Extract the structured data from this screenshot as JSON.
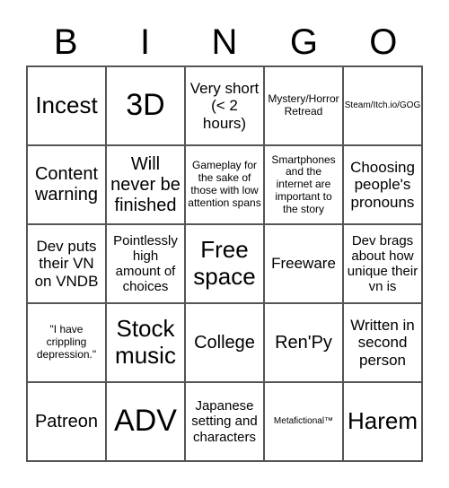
{
  "header": [
    "B",
    "I",
    "N",
    "G",
    "O"
  ],
  "cells": [
    {
      "text": "Incest",
      "size": "s-xl"
    },
    {
      "text": "3D",
      "size": "s-xxl"
    },
    {
      "text": "Very short (< 2 hours)",
      "size": "s-ml"
    },
    {
      "text": "Mystery/Horror Retread",
      "size": "s-s"
    },
    {
      "text": "Steam/Itch.io/GOG",
      "size": "s-xs"
    },
    {
      "text": "Content warning",
      "size": "s-l"
    },
    {
      "text": "Will never be finished",
      "size": "s-l"
    },
    {
      "text": "Gameplay for the sake of those with low attention spans",
      "size": "s-s"
    },
    {
      "text": "Smartphones and the internet are important to the story",
      "size": "s-s"
    },
    {
      "text": "Choosing people's pronouns",
      "size": "s-ml"
    },
    {
      "text": "Dev puts their VN on VNDB",
      "size": "s-ml"
    },
    {
      "text": "Pointlessly high amount of choices",
      "size": "s-m"
    },
    {
      "text": "Free space",
      "size": "s-xl"
    },
    {
      "text": "Freeware",
      "size": "s-ml"
    },
    {
      "text": "Dev brags about how unique their vn is",
      "size": "s-m"
    },
    {
      "text": "\"I have crippling depression.\"",
      "size": "s-s"
    },
    {
      "text": "Stock music",
      "size": "s-xl"
    },
    {
      "text": "College",
      "size": "s-l"
    },
    {
      "text": "Ren'Py",
      "size": "s-l"
    },
    {
      "text": "Written in second person",
      "size": "s-ml"
    },
    {
      "text": "Patreon",
      "size": "s-l"
    },
    {
      "text": "ADV",
      "size": "s-xxl"
    },
    {
      "text": "Japanese setting and characters",
      "size": "s-m"
    },
    {
      "text": "Metafictional™",
      "size": "s-xs"
    },
    {
      "text": "Harem",
      "size": "s-xl"
    }
  ]
}
